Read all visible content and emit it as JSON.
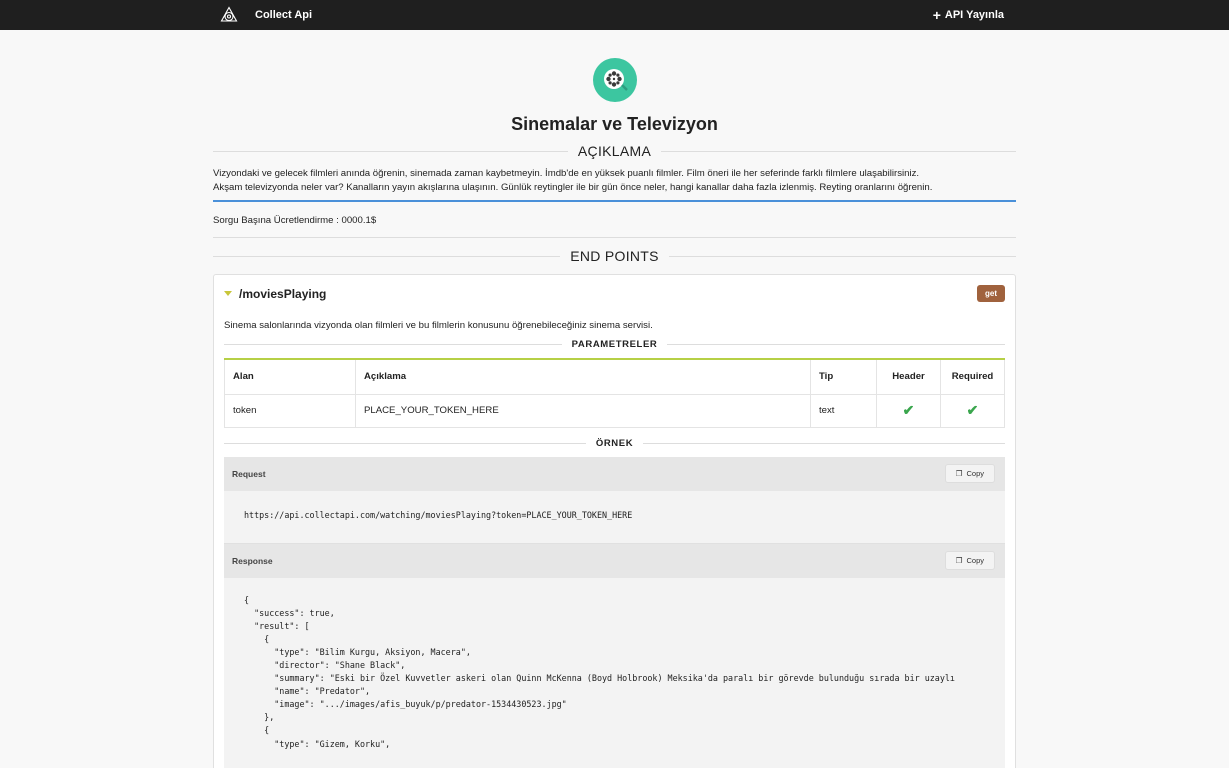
{
  "topbar": {
    "brand": "Collect Api",
    "publish_label": "API Yayınla"
  },
  "hero": {
    "icon": "film-reel-icon",
    "title": "Sinemalar ve Televizyon"
  },
  "description": {
    "heading": "AÇIKLAMA",
    "line1": "Vizyondaki ve gelecek filmleri anında öğrenin, sinemada zaman kaybetmeyin. İmdb'de en yüksek puanlı filmler. Film öneri ile her seferinde farklı filmlere ulaşabilirsiniz.",
    "line2": "Akşam televizyonda neler var? Kanalların yayın akışlarına ulaşının. Günlük reytingler ile bir gün önce neler, hangi kanallar daha fazla izlenmiş. Reyting oranlarını öğrenin."
  },
  "pricing": "Sorgu Başına Ücretlendirme : 0000.1$",
  "endpoints_heading": "END POINTS",
  "endpoint": {
    "path": "/moviesPlaying",
    "method": "get",
    "description": "Sinema salonlarında vizyonda olan filmleri ve bu filmlerin konusunu öğrenebileceğiniz sinema servisi.",
    "params_heading": "PARAMETRELER",
    "columns": [
      "Alan",
      "Açıklama",
      "Tip",
      "Header",
      "Required"
    ],
    "rows": [
      {
        "alan": "token",
        "aciklama": "PLACE_YOUR_TOKEN_HERE",
        "tip": "text",
        "header": true,
        "required": true
      }
    ],
    "example_heading": "ÖRNEK",
    "request_label": "Request",
    "response_label": "Response",
    "copy_label": "Copy",
    "request_url": "https://api.collectapi.com/watching/moviesPlaying?token=PLACE_YOUR_TOKEN_HERE",
    "response_body": "{\n  \"success\": true,\n  \"result\": [\n    {\n      \"type\": \"Bilim Kurgu, Aksiyon, Macera\",\n      \"director\": \"Shane Black\",\n      \"summary\": \"Eski bir Özel Kuvvetler askeri olan Quinn McKenna (Boyd Holbrook) Meksika'da paralı bir görevde bulunduğu sırada bir uzaylı\n      \"name\": \"Predator\",\n      \"image\": \".../images/afis_buyuk/p/predator-1534430523.jpg\"\n    },\n    {\n      \"type\": \"Gizem, Korku\","
  },
  "colors": {
    "topbar": "#1f1f1f",
    "hero_icon": "#3cc6a0",
    "method_badge": "#a0623d",
    "table_accent": "#b6d046",
    "desc_underline": "#4a90d9",
    "check": "#3aa64d"
  }
}
